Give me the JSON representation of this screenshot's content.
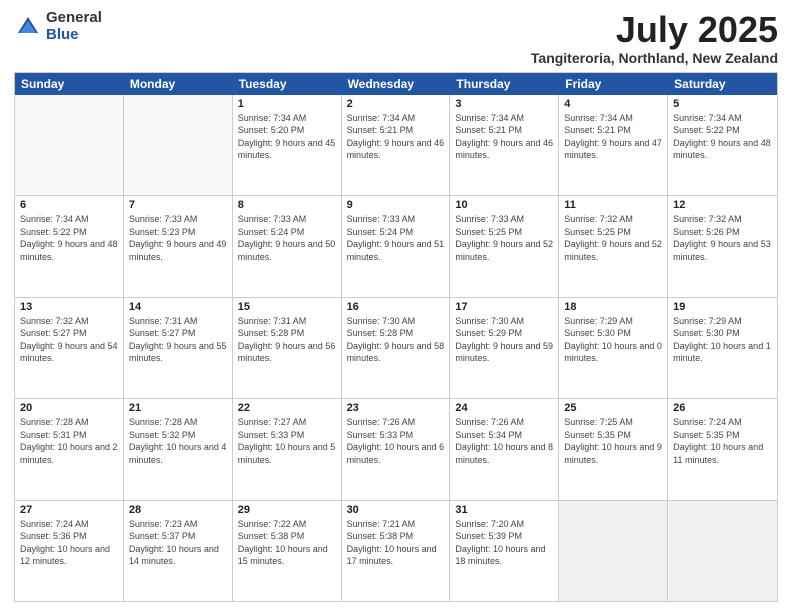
{
  "logo": {
    "general": "General",
    "blue": "Blue"
  },
  "title": "July 2025",
  "subtitle": "Tangiteroria, Northland, New Zealand",
  "days": [
    "Sunday",
    "Monday",
    "Tuesday",
    "Wednesday",
    "Thursday",
    "Friday",
    "Saturday"
  ],
  "weeks": [
    [
      {
        "day": "",
        "info": ""
      },
      {
        "day": "",
        "info": ""
      },
      {
        "day": "1",
        "info": "Sunrise: 7:34 AM\nSunset: 5:20 PM\nDaylight: 9 hours and 45 minutes."
      },
      {
        "day": "2",
        "info": "Sunrise: 7:34 AM\nSunset: 5:21 PM\nDaylight: 9 hours and 46 minutes."
      },
      {
        "day": "3",
        "info": "Sunrise: 7:34 AM\nSunset: 5:21 PM\nDaylight: 9 hours and 46 minutes."
      },
      {
        "day": "4",
        "info": "Sunrise: 7:34 AM\nSunset: 5:21 PM\nDaylight: 9 hours and 47 minutes."
      },
      {
        "day": "5",
        "info": "Sunrise: 7:34 AM\nSunset: 5:22 PM\nDaylight: 9 hours and 48 minutes."
      }
    ],
    [
      {
        "day": "6",
        "info": "Sunrise: 7:34 AM\nSunset: 5:22 PM\nDaylight: 9 hours and 48 minutes."
      },
      {
        "day": "7",
        "info": "Sunrise: 7:33 AM\nSunset: 5:23 PM\nDaylight: 9 hours and 49 minutes."
      },
      {
        "day": "8",
        "info": "Sunrise: 7:33 AM\nSunset: 5:24 PM\nDaylight: 9 hours and 50 minutes."
      },
      {
        "day": "9",
        "info": "Sunrise: 7:33 AM\nSunset: 5:24 PM\nDaylight: 9 hours and 51 minutes."
      },
      {
        "day": "10",
        "info": "Sunrise: 7:33 AM\nSunset: 5:25 PM\nDaylight: 9 hours and 52 minutes."
      },
      {
        "day": "11",
        "info": "Sunrise: 7:32 AM\nSunset: 5:25 PM\nDaylight: 9 hours and 52 minutes."
      },
      {
        "day": "12",
        "info": "Sunrise: 7:32 AM\nSunset: 5:26 PM\nDaylight: 9 hours and 53 minutes."
      }
    ],
    [
      {
        "day": "13",
        "info": "Sunrise: 7:32 AM\nSunset: 5:27 PM\nDaylight: 9 hours and 54 minutes."
      },
      {
        "day": "14",
        "info": "Sunrise: 7:31 AM\nSunset: 5:27 PM\nDaylight: 9 hours and 55 minutes."
      },
      {
        "day": "15",
        "info": "Sunrise: 7:31 AM\nSunset: 5:28 PM\nDaylight: 9 hours and 56 minutes."
      },
      {
        "day": "16",
        "info": "Sunrise: 7:30 AM\nSunset: 5:28 PM\nDaylight: 9 hours and 58 minutes."
      },
      {
        "day": "17",
        "info": "Sunrise: 7:30 AM\nSunset: 5:29 PM\nDaylight: 9 hours and 59 minutes."
      },
      {
        "day": "18",
        "info": "Sunrise: 7:29 AM\nSunset: 5:30 PM\nDaylight: 10 hours and 0 minutes."
      },
      {
        "day": "19",
        "info": "Sunrise: 7:29 AM\nSunset: 5:30 PM\nDaylight: 10 hours and 1 minute."
      }
    ],
    [
      {
        "day": "20",
        "info": "Sunrise: 7:28 AM\nSunset: 5:31 PM\nDaylight: 10 hours and 2 minutes."
      },
      {
        "day": "21",
        "info": "Sunrise: 7:28 AM\nSunset: 5:32 PM\nDaylight: 10 hours and 4 minutes."
      },
      {
        "day": "22",
        "info": "Sunrise: 7:27 AM\nSunset: 5:33 PM\nDaylight: 10 hours and 5 minutes."
      },
      {
        "day": "23",
        "info": "Sunrise: 7:26 AM\nSunset: 5:33 PM\nDaylight: 10 hours and 6 minutes."
      },
      {
        "day": "24",
        "info": "Sunrise: 7:26 AM\nSunset: 5:34 PM\nDaylight: 10 hours and 8 minutes."
      },
      {
        "day": "25",
        "info": "Sunrise: 7:25 AM\nSunset: 5:35 PM\nDaylight: 10 hours and 9 minutes."
      },
      {
        "day": "26",
        "info": "Sunrise: 7:24 AM\nSunset: 5:35 PM\nDaylight: 10 hours and 11 minutes."
      }
    ],
    [
      {
        "day": "27",
        "info": "Sunrise: 7:24 AM\nSunset: 5:36 PM\nDaylight: 10 hours and 12 minutes."
      },
      {
        "day": "28",
        "info": "Sunrise: 7:23 AM\nSunset: 5:37 PM\nDaylight: 10 hours and 14 minutes."
      },
      {
        "day": "29",
        "info": "Sunrise: 7:22 AM\nSunset: 5:38 PM\nDaylight: 10 hours and 15 minutes."
      },
      {
        "day": "30",
        "info": "Sunrise: 7:21 AM\nSunset: 5:38 PM\nDaylight: 10 hours and 17 minutes."
      },
      {
        "day": "31",
        "info": "Sunrise: 7:20 AM\nSunset: 5:39 PM\nDaylight: 10 hours and 18 minutes."
      },
      {
        "day": "",
        "info": ""
      },
      {
        "day": "",
        "info": ""
      }
    ]
  ]
}
